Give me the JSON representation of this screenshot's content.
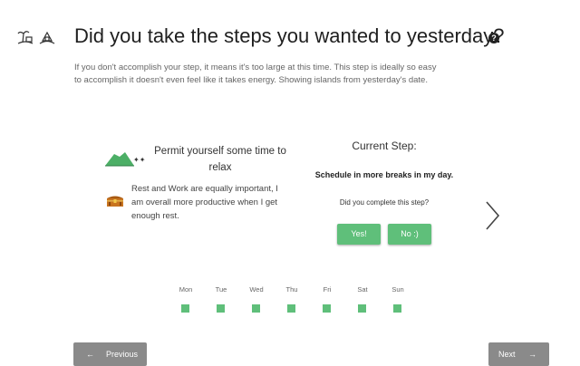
{
  "header": {
    "title": "Did you take the steps you wanted to yesterday?",
    "help_glyph": "?",
    "icons": [
      "island-palm-icon",
      "island-house-icon"
    ]
  },
  "description": "If you don't accomplish your step, it means it's too large at this time. This step is ideally so easy to accomplish it doesn't even feel like it takes energy. Showing islands from yesterday's date.",
  "goal": {
    "title": "Permit yourself some time to relax",
    "text": "Rest and Work are equally important, I am overall more productive when I get enough rest.",
    "island_icon": "green-island-icon",
    "reward_icon": "treasure-chest-icon"
  },
  "current": {
    "label": "Current Step:",
    "step": "Schedule in more breaks in my day.",
    "question": "Did you complete this step?",
    "yes_label": "Yes!",
    "no_label": "No :)"
  },
  "days": [
    "Mon",
    "Tue",
    "Wed",
    "Thu",
    "Fri",
    "Sat",
    "Sun"
  ],
  "nav": {
    "previous_label": "Previous",
    "next_label": "Next",
    "prev_arrow": "←",
    "next_arrow": "→"
  },
  "colors": {
    "accent": "#5fbf7a",
    "nav_button": "#8a8a8a"
  }
}
